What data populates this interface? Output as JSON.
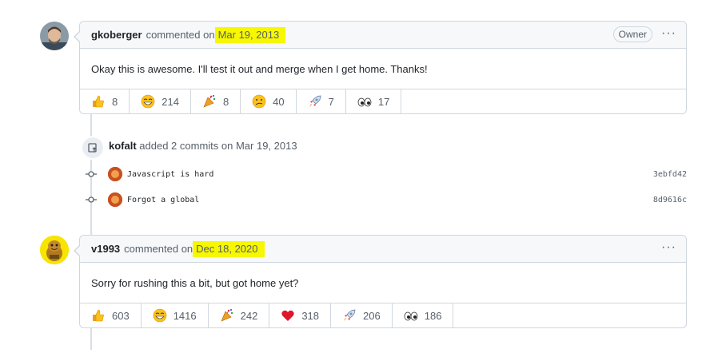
{
  "comment1": {
    "author": "gkoberger",
    "action": "commented on",
    "date": "Mar 19, 2013",
    "badge": "Owner",
    "more": "···",
    "body": "Okay this is awesome. I'll test it out and merge when I get home. Thanks!",
    "reactions": [
      {
        "icon": "thumbs-up-icon",
        "count": "8"
      },
      {
        "icon": "laugh-icon",
        "count": "214"
      },
      {
        "icon": "hooray-icon",
        "count": "8"
      },
      {
        "icon": "confused-icon",
        "count": "40"
      },
      {
        "icon": "rocket-icon",
        "count": "7"
      },
      {
        "icon": "eyes-icon",
        "count": "17"
      }
    ]
  },
  "event": {
    "user": "kofalt",
    "text": "added 2 commits on Mar 19, 2013"
  },
  "commits": [
    {
      "message": "Javascript is hard",
      "sha": "3ebfd42"
    },
    {
      "message": "Forgot a global",
      "sha": "8d9616c"
    }
  ],
  "comment2": {
    "author": "v1993",
    "action": "commented on",
    "date": "Dec 18, 2020",
    "more": "···",
    "body": "Sorry for rushing this a bit, but got home yet?",
    "reactions": [
      {
        "icon": "thumbs-up-icon",
        "count": "603"
      },
      {
        "icon": "laugh-icon",
        "count": "1416"
      },
      {
        "icon": "hooray-icon",
        "count": "242"
      },
      {
        "icon": "heart-icon",
        "count": "318"
      },
      {
        "icon": "rocket-icon",
        "count": "206"
      },
      {
        "icon": "eyes-icon",
        "count": "186"
      }
    ]
  },
  "colors": {
    "highlight": "#f7f700",
    "border": "#d0d7de",
    "header_bg": "#f6f8fa"
  }
}
